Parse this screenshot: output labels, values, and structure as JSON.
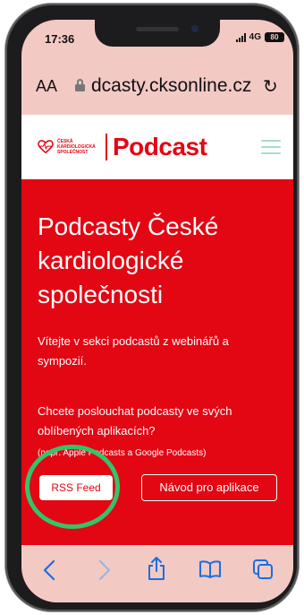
{
  "status": {
    "time": "17:36",
    "network": "4G",
    "battery": "80"
  },
  "browser": {
    "text_size_label": "AA",
    "url": "dcasty.cksonline.cz",
    "reload_icon": "reload-icon",
    "lock_icon": "lock-icon"
  },
  "site": {
    "org_line1": "ČESKÁ",
    "org_line2": "KARDIOLOGICKÁ",
    "org_line3": "SPOLEČNOST",
    "brand_title": "Podcast",
    "menu_icon": "hamburger-icon"
  },
  "hero": {
    "title": "Podcasty České kardiologické společnosti",
    "intro": "Vítejte v sekci podcastů z webinářů a sympozií.",
    "question": "Chcete poslouchat podcasty ve svých oblíbených aplikacích?",
    "hint": "(např. Apple Podcasts a Google Podcasts)",
    "rss_button": "RSS Feed",
    "guide_button": "Návod pro aplikace"
  },
  "toolbar": {
    "items": [
      "back-icon",
      "forward-icon",
      "share-icon",
      "bookmarks-icon",
      "tabs-icon"
    ]
  },
  "colors": {
    "brand_red": "#e30613",
    "ui_tint": "#f3c9c4",
    "ios_blue": "#1a6fe0",
    "highlight_green": "#33c46a",
    "menu_green": "#a8dcc4"
  }
}
